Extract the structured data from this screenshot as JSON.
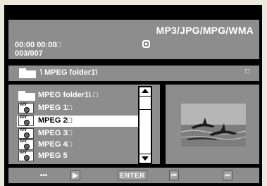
{
  "header": {
    "title": "MP3/JPG/MPG/WMA",
    "time": "00:00  00:00□",
    "track": "003/007"
  },
  "path": {
    "label": "\\ MPEG folder1\\",
    "end_glyph": "□"
  },
  "list": {
    "items": [
      {
        "label": "MPEG folder1\\  □",
        "icon": "folder-icon"
      },
      {
        "label": "MPEG 1□",
        "icon": "av-disc-icon"
      },
      {
        "label": "MPEG 2□",
        "icon": "av-disc-icon",
        "selected": true
      },
      {
        "label": "MPEG 3□",
        "icon": "av-disc-icon"
      },
      {
        "label": "MPEG 4□",
        "icon": "av-disc-icon"
      },
      {
        "label": "MPEG 5",
        "icon": "av-disc-icon"
      }
    ],
    "av_text": "A/V"
  },
  "controls": {
    "dpad": "•••",
    "play": "▶",
    "enter": "ENTER",
    "prev": "⏮",
    "next": "⏭"
  }
}
